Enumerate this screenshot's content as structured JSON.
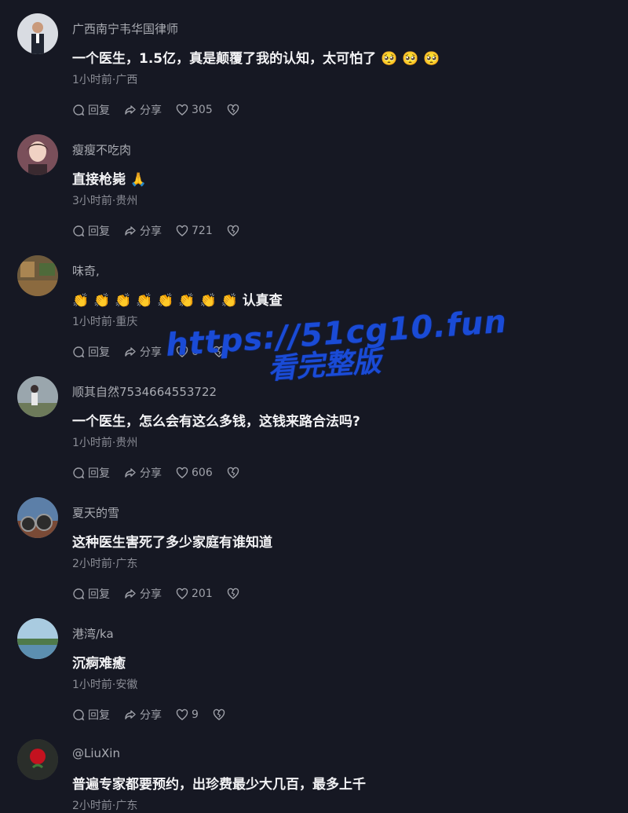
{
  "comments": [
    {
      "user": "广西南宁韦华国律师",
      "text": "一个医生，1.5亿，真是颠覆了我的认知，太可怕了",
      "emoji": "🥺 🥺 🥺",
      "meta": "1小时前·广西",
      "reply": "回复",
      "share": "分享",
      "likes": "305",
      "avatar": "person-suit-avatar"
    },
    {
      "user": "瘦瘦不吃肉",
      "text": "直接枪毙",
      "emoji": "🙏",
      "meta": "3小时前·贵州",
      "reply": "回复",
      "share": "分享",
      "likes": "721",
      "avatar": "woman-portrait-avatar"
    },
    {
      "user": "味奇,",
      "text": "认真查",
      "emoji_prefix": "👏 👏 👏 👏 👏 👏 👏 👏",
      "meta": "1小时前·重庆",
      "reply": "回复",
      "share": "分享",
      "likes": "6",
      "avatar": "room-photo-avatar"
    },
    {
      "user": "顺其自然7534664553722",
      "text": "一个医生，怎么会有这么多钱，这钱来路合法吗?",
      "meta": "1小时前·贵州",
      "reply": "回复",
      "share": "分享",
      "likes": "606",
      "avatar": "outdoor-person-avatar"
    },
    {
      "user": "夏天的雪",
      "text": "这种医生害死了多少家庭有谁知道",
      "meta": "2小时前·广东",
      "reply": "回复",
      "share": "分享",
      "likes": "201",
      "avatar": "pipes-avatar"
    },
    {
      "user": "港湾/ka",
      "text": "沉痾难癒",
      "meta": "1小时前·安徽",
      "reply": "回复",
      "share": "分享",
      "likes": "9",
      "avatar": "lake-avatar"
    },
    {
      "user": "@LiuXin",
      "text": "普遍专家都要预约，出珍费最少大几百，最多上千",
      "meta": "2小时前·广东",
      "reply": "",
      "share": "",
      "likes": "",
      "avatar": "rose-avatar"
    }
  ],
  "watermark": {
    "line1": "https://51cg10.fun",
    "line2": "看完整版",
    "color": "#1a4bd6"
  },
  "colors": {
    "background": "#161823",
    "username": "#a9abb2",
    "text": "#f2f2f4",
    "meta": "#8a8c95"
  }
}
